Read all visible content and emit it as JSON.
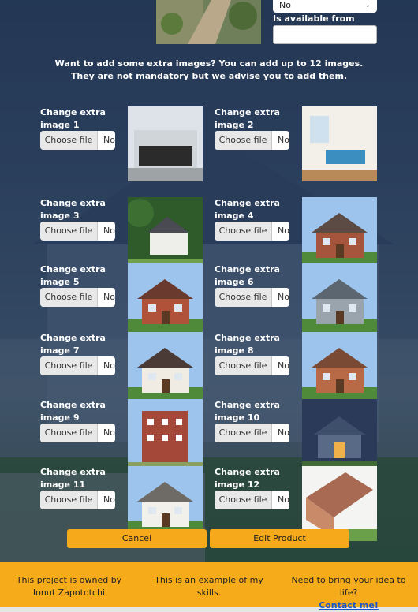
{
  "availability": {
    "select_value": "No",
    "available_from_label": "Is available from",
    "available_from_value": ""
  },
  "intro_text": "Want to add some extra images? You can add up to 12 images. They are not mandatory but we advise you to add them.",
  "extra_images": [
    {
      "label": "Change extra image 1",
      "button": "Choose file",
      "file_text": "No",
      "scene": "modern-building"
    },
    {
      "label": "Change extra image 2",
      "button": "Choose file",
      "file_text": "No",
      "scene": "bedroom-interior"
    },
    {
      "label": "Change extra image 3",
      "button": "Choose file",
      "file_text": "No",
      "scene": "white-house-trees"
    },
    {
      "label": "Change extra image 4",
      "button": "Choose file",
      "file_text": "No",
      "scene": "brick-townhouses"
    },
    {
      "label": "Change extra image 5",
      "button": "Choose file",
      "file_text": "No",
      "scene": "red-brick-house"
    },
    {
      "label": "Change extra image 6",
      "button": "Choose file",
      "file_text": "No",
      "scene": "grey-suburban-house"
    },
    {
      "label": "Change extra image 7",
      "button": "Choose file",
      "file_text": "No",
      "scene": "terraced-houses"
    },
    {
      "label": "Change extra image 8",
      "button": "Choose file",
      "file_text": "No",
      "scene": "brick-house-garage"
    },
    {
      "label": "Change extra image 9",
      "button": "Choose file",
      "file_text": "No",
      "scene": "brick-apartments"
    },
    {
      "label": "Change extra image 10",
      "button": "Choose file",
      "file_text": "No",
      "scene": "house-at-dusk"
    },
    {
      "label": "Change extra image 11",
      "button": "Choose file",
      "file_text": "No",
      "scene": "white-two-storey-house"
    },
    {
      "label": "Change extra image 12",
      "button": "Choose file",
      "file_text": "No",
      "scene": "house-aerial-view"
    }
  ],
  "actions": {
    "cancel": "Cancel",
    "edit": "Edit Product"
  },
  "footer": {
    "owner": "This project is owned by Ionut Zapototchi",
    "example": "This is an example of my skills.",
    "cta": "Need to bring your idea to life?",
    "contact_link": "Contact me!"
  },
  "colors": {
    "accent": "#f6ab1a",
    "link": "#1a55c9"
  }
}
